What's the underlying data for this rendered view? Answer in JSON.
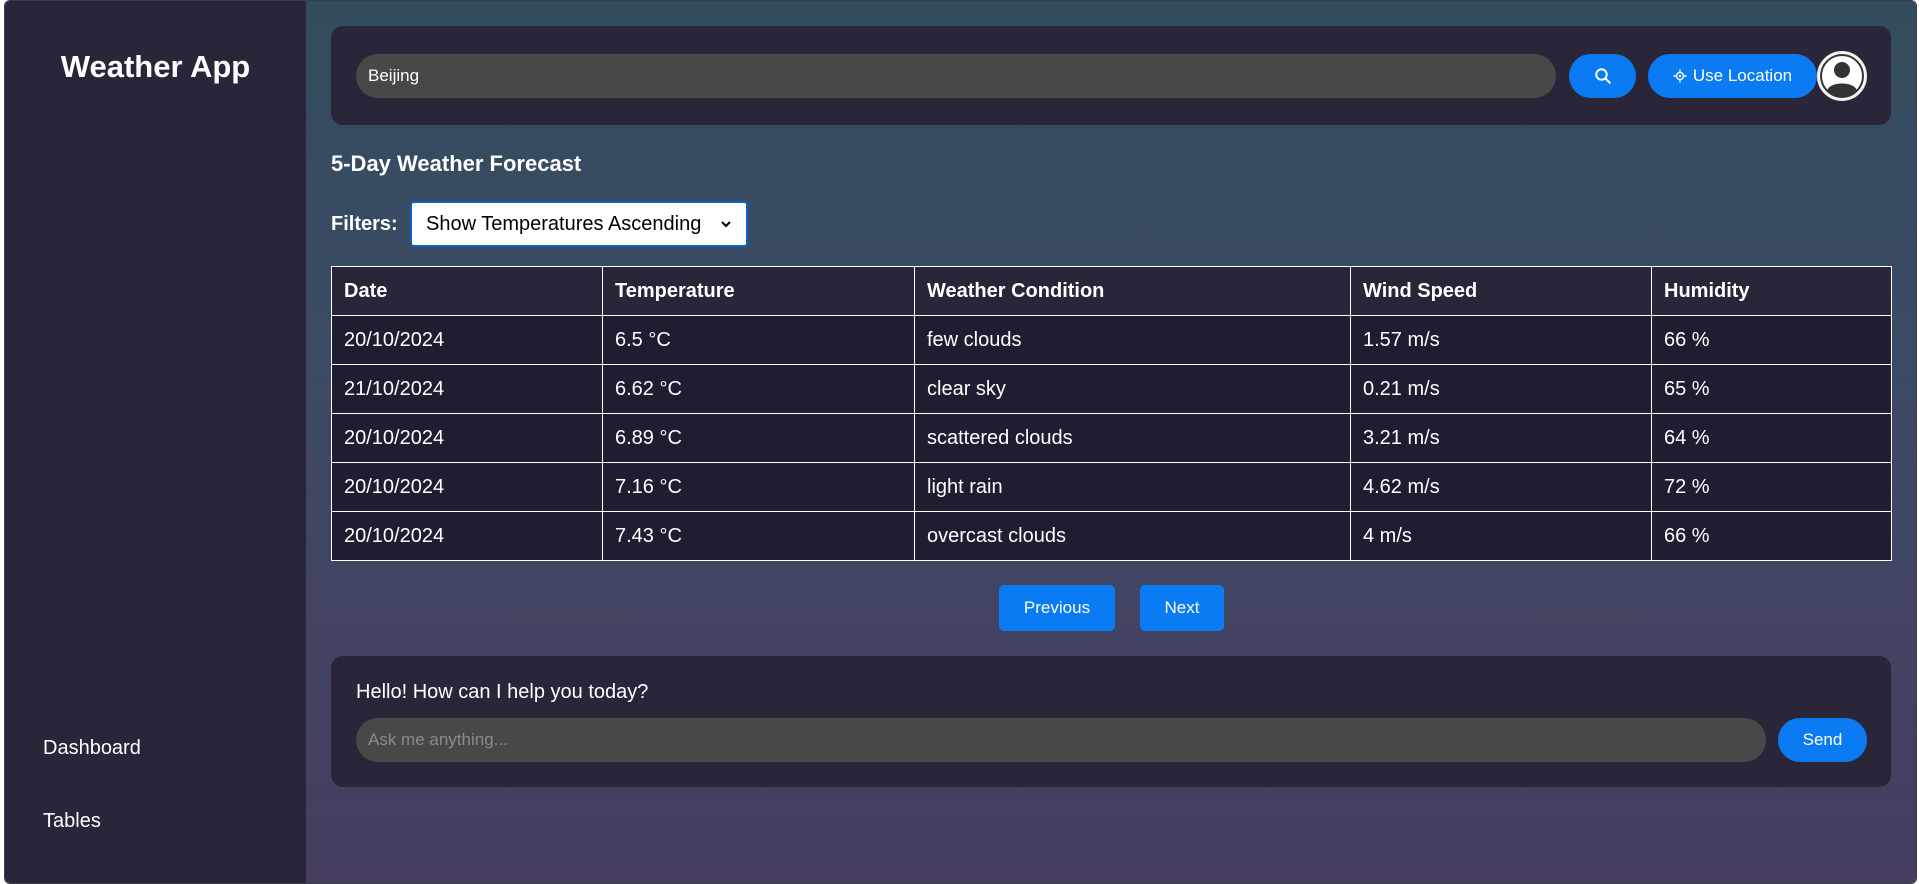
{
  "sidebar": {
    "brand": "Weather App",
    "items": [
      {
        "label": "Dashboard"
      },
      {
        "label": "Tables"
      }
    ]
  },
  "search": {
    "value": "Beijing",
    "placeholder": "",
    "search_icon": "search-icon",
    "location_label": "Use Location",
    "location_icon": "crosshair-icon"
  },
  "forecast": {
    "title": "5-Day Weather Forecast",
    "filters_label": "Filters:",
    "filter_selected": "Show Temperatures Ascending",
    "columns": [
      "Date",
      "Temperature",
      "Weather Condition",
      "Wind Speed",
      "Humidity"
    ],
    "rows": [
      [
        "20/10/2024",
        "6.5 °C",
        "few clouds",
        "1.57 m/s",
        "66 %"
      ],
      [
        "21/10/2024",
        "6.62 °C",
        "clear sky",
        "0.21 m/s",
        "65 %"
      ],
      [
        "20/10/2024",
        "6.89 °C",
        "scattered clouds",
        "3.21 m/s",
        "64 %"
      ],
      [
        "20/10/2024",
        "7.16 °C",
        "light rain",
        "4.62 m/s",
        "72 %"
      ],
      [
        "20/10/2024",
        "7.43 °C",
        "overcast clouds",
        "4 m/s",
        "66 %"
      ]
    ]
  },
  "pagination": {
    "previous_label": "Previous",
    "next_label": "Next"
  },
  "chat": {
    "greeting": "Hello! How can I help you today?",
    "placeholder": "Ask me anything...",
    "send_label": "Send"
  },
  "colors": {
    "accent": "#0a7bf2",
    "panel": "#2a2538",
    "cell": "#1f1d30"
  }
}
